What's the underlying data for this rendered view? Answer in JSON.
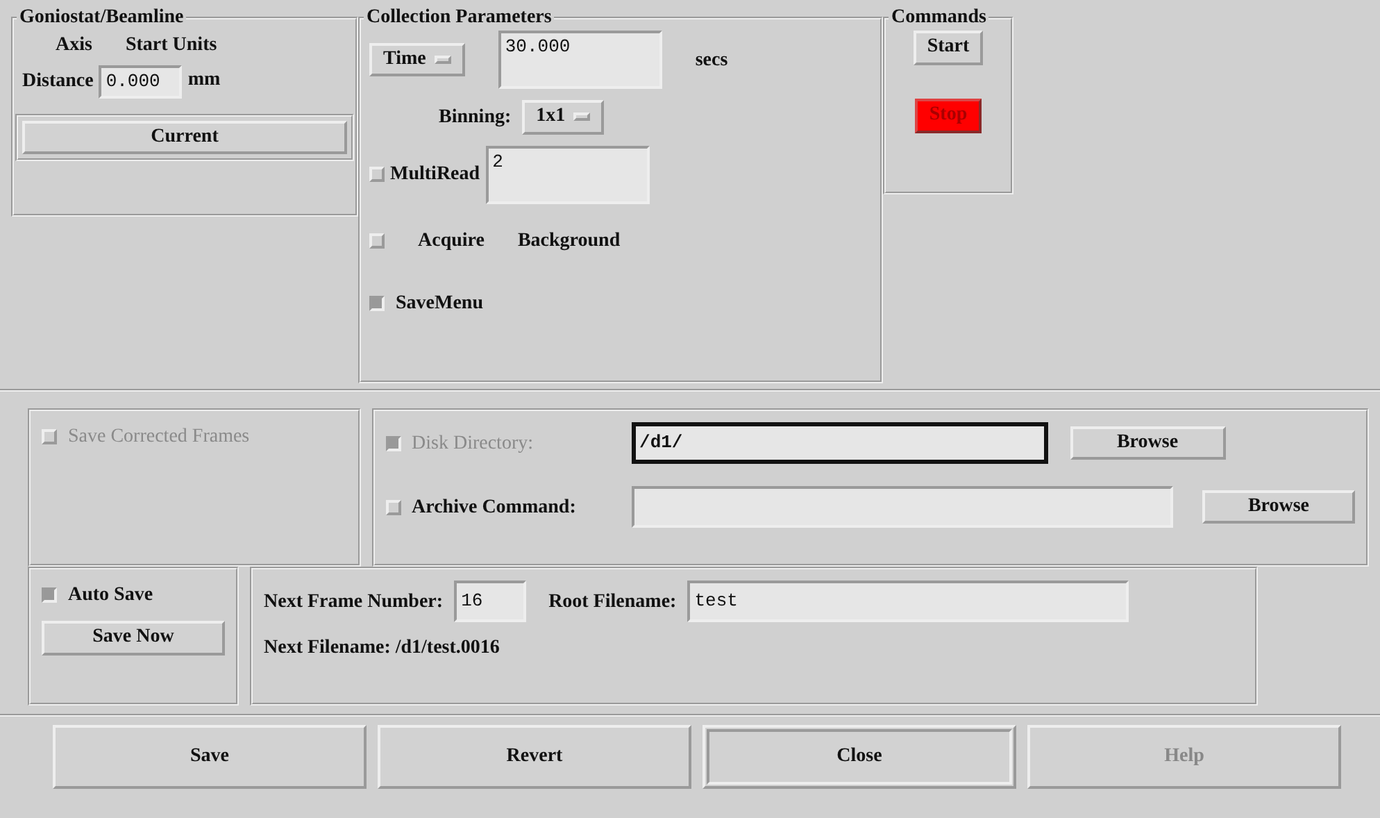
{
  "goniostat": {
    "title": "Goniostat/Beamline",
    "columns": [
      "Axis",
      "Start Units"
    ],
    "axis": {
      "label": "Distance",
      "value": "0.000",
      "unit": "mm"
    },
    "button": "Current"
  },
  "collection": {
    "title": "Collection Parameters",
    "mode_menu": "Time",
    "time_value": "30.000",
    "time_unit": "secs",
    "binning_label": "Binning:",
    "binning_menu": "1x1",
    "multiread": {
      "label": "MultiRead",
      "checked": false,
      "value": "2"
    },
    "acquire": {
      "checked": false,
      "labels": [
        "Acquire",
        "Background"
      ]
    },
    "savemenu": {
      "label": "SaveMenu",
      "checked": true
    }
  },
  "commands": {
    "title": "Commands",
    "buttons": [
      {
        "label": "Start",
        "kind": "normal"
      },
      {
        "label": "Stop",
        "kind": "danger"
      }
    ]
  },
  "save_corrected": {
    "label": "Save Corrected Frames",
    "checked": false,
    "disabled": true
  },
  "disk_directory": {
    "label": "Disk Directory:",
    "checked": true,
    "disabled": true,
    "value": "/d1/",
    "focused": true,
    "browse": "Browse"
  },
  "archive_command": {
    "label": "Archive Command:",
    "checked": false,
    "disabled": false,
    "focused": false,
    "browse": "Browse"
  },
  "auto_save": {
    "label": "Auto Save",
    "checked": true,
    "button": "Save Now"
  },
  "next_frame": {
    "label": "Next Frame Number:",
    "value": "16"
  },
  "root_filename": {
    "label": "Root Filename:",
    "value": "test"
  },
  "next_filename": "Next Filename: /d1/test.0016",
  "footer": [
    {
      "label": "Save",
      "disabled": false,
      "default": false
    },
    {
      "label": "Revert",
      "disabled": false,
      "default": false
    },
    {
      "label": "Close",
      "disabled": false,
      "default": true
    },
    {
      "label": "Help",
      "disabled": true,
      "default": false
    }
  ]
}
